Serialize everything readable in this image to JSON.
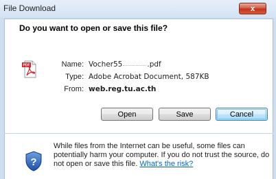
{
  "window": {
    "title": "File Download",
    "close_glyph": "x"
  },
  "dialog": {
    "heading": "Do you want to open or save this file?",
    "fields": {
      "name_label": "Name:",
      "name_value_prefix": "Vocher55",
      "name_value_suffix": ".pdf",
      "type_label": "Type:",
      "type_value": "Adobe Acrobat Document, 587KB",
      "from_label": "From:",
      "from_value": "web.reg.tu.ac.th"
    },
    "buttons": {
      "open": "Open",
      "save": "Save",
      "cancel": "Cancel"
    },
    "warning": {
      "text": "While files from the Internet can be useful, some files can potentially harm your computer. If you do not trust the source, do not open or save this file.",
      "link": "What's the risk?"
    },
    "icons": {
      "file": "pdf-file-icon",
      "security": "security-shield-icon",
      "close": "close-icon"
    },
    "colors": {
      "frame": "#cfdff1",
      "close_button": "#c1301a",
      "link": "#0066cc",
      "pdf_red": "#d0222a"
    },
    "pdf_badge": "PDF"
  }
}
